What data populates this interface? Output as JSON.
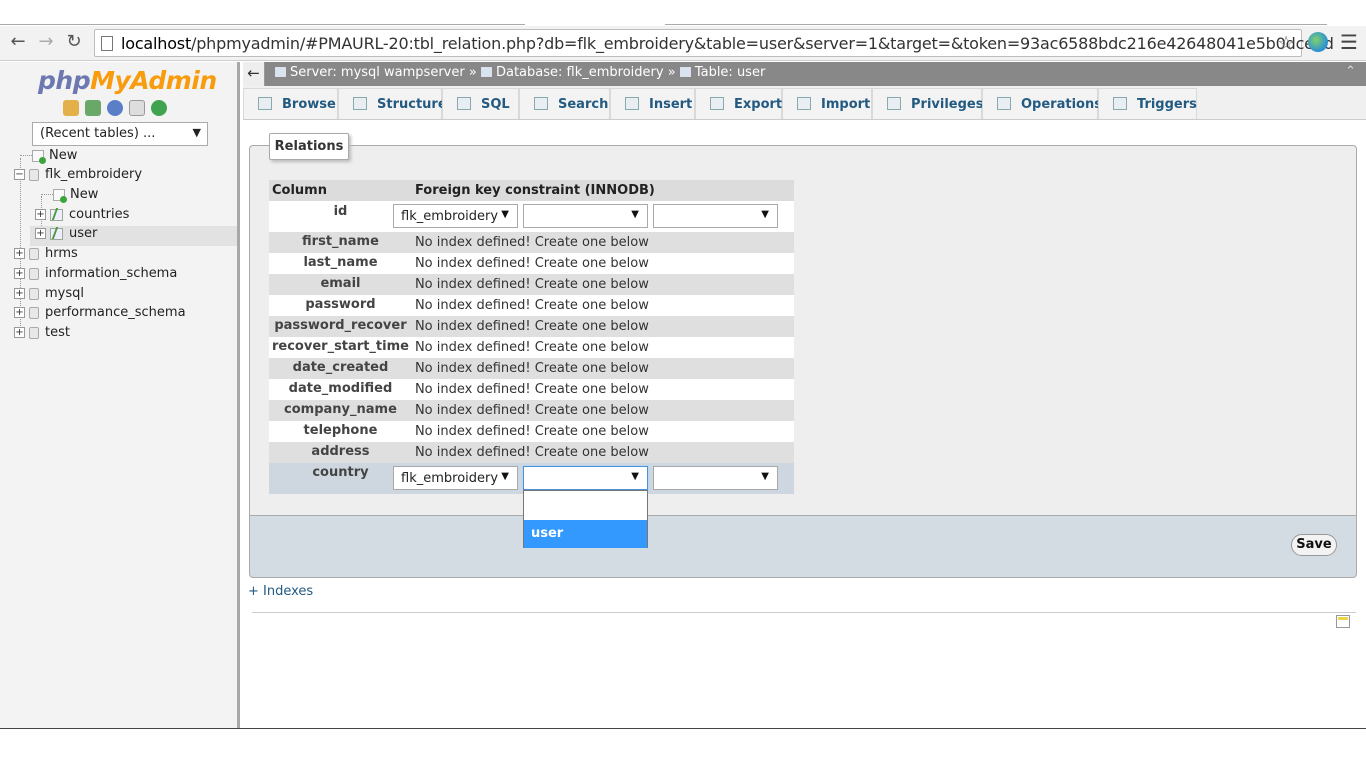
{
  "browser": {
    "url_host": "localhost",
    "url_path": "/phpmyadmin/#PMAURL-20:tbl_relation.php?db=flk_embroidery&table=user&server=1&target=&token=93ac6588bdc216e42648041e5b0dce2d"
  },
  "sidebar": {
    "logo_php": "php",
    "logo_my": "My",
    "logo_admin": "Admin",
    "recent_tables": "(Recent tables) ...",
    "tree": [
      {
        "label": "New"
      },
      {
        "label": "flk_embroidery"
      },
      {
        "label": "New"
      },
      {
        "label": "countries"
      },
      {
        "label": "user"
      },
      {
        "label": "hrms"
      },
      {
        "label": "information_schema"
      },
      {
        "label": "mysql"
      },
      {
        "label": "performance_schema"
      },
      {
        "label": "test"
      }
    ]
  },
  "breadcrumb": {
    "server": "Server: mysql wampserver",
    "database": "Database: flk_embroidery",
    "table": "Table: user",
    "sep": "»"
  },
  "tabs": [
    "Browse",
    "Structure",
    "SQL",
    "Search",
    "Insert",
    "Export",
    "Import",
    "Privileges",
    "Operations",
    "Triggers"
  ],
  "relations": {
    "legend": "Relations",
    "header_column": "Column",
    "header_fk": "Foreign key constraint (INNODB)",
    "no_index_msg": "No index defined! Create one below",
    "rows": [
      {
        "column": "id"
      },
      {
        "column": "first_name"
      },
      {
        "column": "last_name"
      },
      {
        "column": "email"
      },
      {
        "column": "password"
      },
      {
        "column": "password_recover"
      },
      {
        "column": "recover_start_time"
      },
      {
        "column": "date_created"
      },
      {
        "column": "date_modified"
      },
      {
        "column": "company_name"
      },
      {
        "column": "telephone"
      },
      {
        "column": "address"
      },
      {
        "column": "country"
      }
    ],
    "db_select_value": "flk_embroidery",
    "dropdown_option": "user",
    "save_label": "Save"
  },
  "indexes_link": "+ Indexes"
}
